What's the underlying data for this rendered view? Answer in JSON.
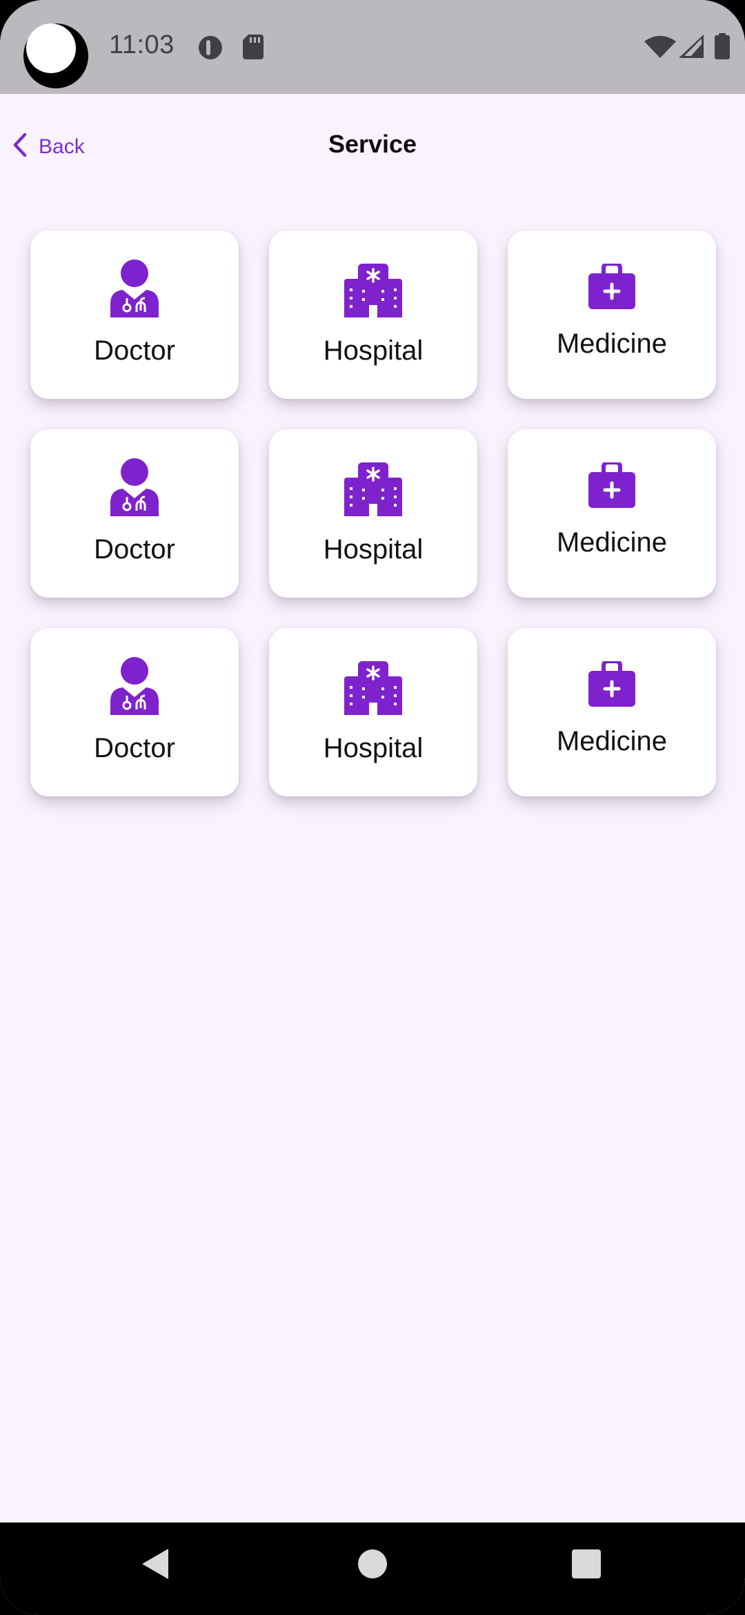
{
  "status_bar": {
    "time": "11:03",
    "left_icons": [
      "pill-icon",
      "sd-card-icon"
    ],
    "right_icons": [
      "wifi-icon",
      "signal-icon",
      "battery-icon"
    ]
  },
  "header": {
    "back_label": "Back",
    "title": "Service"
  },
  "colors": {
    "accent": "#7b2fc9",
    "icon": "#7e22ce",
    "background": "#faf3fe",
    "card": "#ffffff",
    "status_bar": "#bbb8be"
  },
  "services": [
    {
      "label": "Doctor",
      "icon": "doctor-icon"
    },
    {
      "label": "Hospital",
      "icon": "hospital-icon"
    },
    {
      "label": "Medicine",
      "icon": "medicine-icon"
    },
    {
      "label": "Doctor",
      "icon": "doctor-icon"
    },
    {
      "label": "Hospital",
      "icon": "hospital-icon"
    },
    {
      "label": "Medicine",
      "icon": "medicine-icon"
    },
    {
      "label": "Doctor",
      "icon": "doctor-icon"
    },
    {
      "label": "Hospital",
      "icon": "hospital-icon"
    },
    {
      "label": "Medicine",
      "icon": "medicine-icon"
    }
  ],
  "nav": {
    "buttons": [
      "back-nav-icon",
      "home-nav-icon",
      "recents-nav-icon"
    ]
  }
}
